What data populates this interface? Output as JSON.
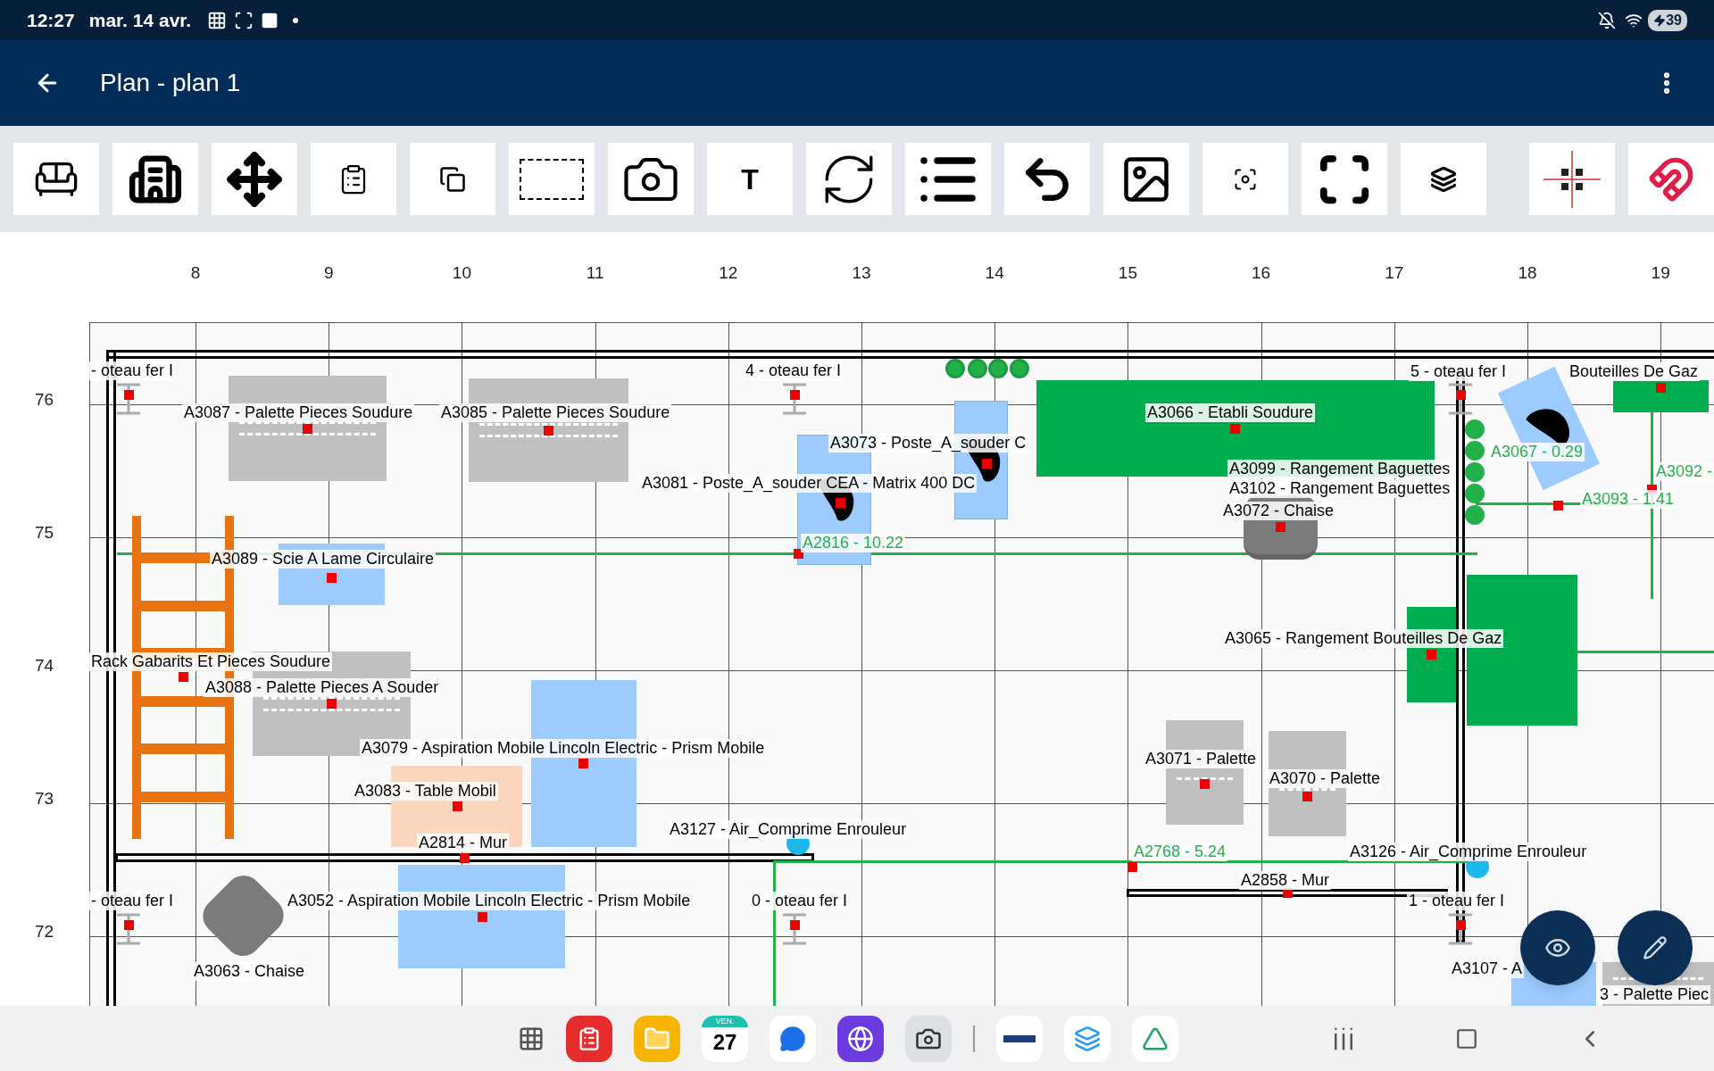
{
  "status_bar": {
    "time": "12:27",
    "date": "mar. 14 avr.",
    "battery": "39"
  },
  "app_bar": {
    "title": "Plan - plan 1"
  },
  "toolbar": [
    {
      "kind": "furniture"
    },
    {
      "kind": "building"
    },
    {
      "kind": "move"
    },
    {
      "kind": "paste"
    },
    {
      "kind": "copy"
    },
    {
      "kind": "select"
    },
    {
      "kind": "camera"
    },
    {
      "kind": "text",
      "label": "T"
    },
    {
      "kind": "rotate"
    },
    {
      "kind": "list"
    },
    {
      "kind": "undo"
    },
    {
      "kind": "image"
    },
    {
      "kind": "focus"
    },
    {
      "kind": "frame"
    },
    {
      "kind": "layers"
    },
    {
      "kind": "crosshair"
    },
    {
      "kind": "magnet"
    }
  ],
  "plan": {
    "x_axis": [
      "8",
      "9",
      "10",
      "11",
      "12",
      "13",
      "14",
      "15",
      "16",
      "17",
      "18",
      "19"
    ],
    "y_axis": [
      "76",
      "75",
      "74",
      "73",
      "72"
    ],
    "labels": [
      {
        "text": "- oteau fer I",
        "kind": "name"
      },
      {
        "text": "4 - oteau fer I",
        "kind": "name"
      },
      {
        "text": "5 - oteau fer I",
        "kind": "name"
      },
      {
        "text": "Bouteilles De Gaz",
        "kind": "name"
      },
      {
        "text": "A3087 - Palette Pieces Soudure",
        "kind": "name"
      },
      {
        "text": "A3085 - Palette Pieces Soudure",
        "kind": "name"
      },
      {
        "text": "A3066 - Etabli Soudure",
        "kind": "name"
      },
      {
        "text": "A3073 - Poste_A_souder C",
        "kind": "name"
      },
      {
        "text": "A3067 - 0.29",
        "kind": "measure"
      },
      {
        "text": "A3099 - Rangement Baguettes",
        "kind": "name"
      },
      {
        "text": "A3092 -",
        "kind": "measure"
      },
      {
        "text": "A3081 - Poste_A_souder CEA - Matrix 400 DC",
        "kind": "name"
      },
      {
        "text": "A3102 - Rangement Baguettes",
        "kind": "name"
      },
      {
        "text": "A3093 - 1.41",
        "kind": "measure"
      },
      {
        "text": "A3072 - Chaise",
        "kind": "name"
      },
      {
        "text": "A2816 - 10.22",
        "kind": "measure"
      },
      {
        "text": "A3089 - Scie A Lame Circulaire",
        "kind": "name"
      },
      {
        "text": "A3065 - Rangement Bouteilles De Gaz",
        "kind": "name"
      },
      {
        "text": "Rack Gabarits Et Pieces Soudure",
        "kind": "name"
      },
      {
        "text": "A3088 - Palette Pieces A Souder",
        "kind": "name"
      },
      {
        "text": "A3079 - Aspiration Mobile Lincoln Electric - Prism Mobile",
        "kind": "name"
      },
      {
        "text": "A3071 - Palette",
        "kind": "name"
      },
      {
        "text": "A3070 - Palette",
        "kind": "name"
      },
      {
        "text": "A3083 - Table Mobil",
        "kind": "name"
      },
      {
        "text": "A3127 - Air_Comprime Enrouleur",
        "kind": "name"
      },
      {
        "text": "A2814 - Mur",
        "kind": "name"
      },
      {
        "text": "A2768 - 5.24",
        "kind": "measure"
      },
      {
        "text": "A3126 - Air_Comprime Enrouleur",
        "kind": "name"
      },
      {
        "text": "A2858 - Mur",
        "kind": "name"
      },
      {
        "text": "- oteau fer I",
        "kind": "name"
      },
      {
        "text": "A3052 - Aspiration Mobile Lincoln Electric - Prism Mobile",
        "kind": "name"
      },
      {
        "text": "0 - oteau fer I",
        "kind": "name"
      },
      {
        "text": "1 - oteau fer I",
        "kind": "name"
      },
      {
        "text": "A3107 - A",
        "kind": "name"
      },
      {
        "text": "A3063 - Chaise",
        "kind": "name"
      },
      {
        "text": "3 - Palette Piec",
        "kind": "name"
      }
    ]
  },
  "dock": {
    "calendar_day": "VEN.",
    "calendar_date": "27"
  }
}
